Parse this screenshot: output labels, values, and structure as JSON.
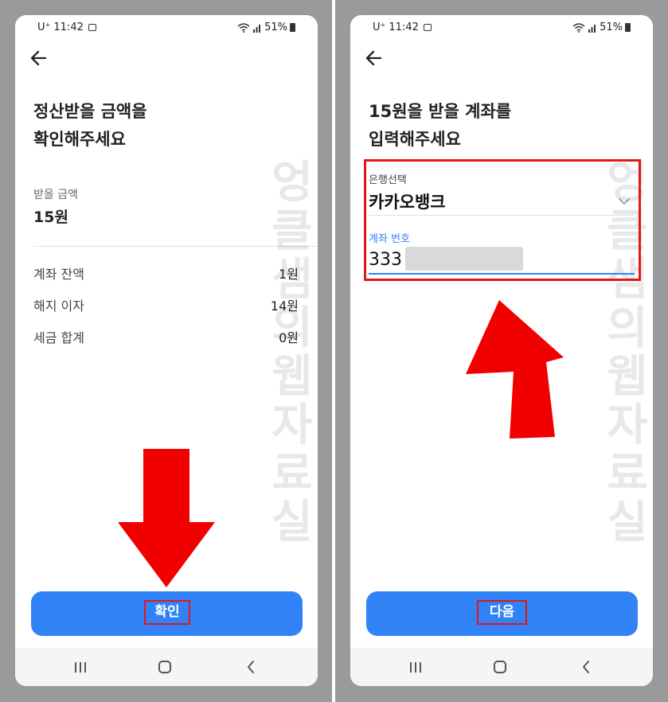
{
  "status_bar": {
    "carrier": "U⁺",
    "time": "11:42",
    "battery": "51%"
  },
  "left_screen": {
    "title_line1": "정산받을 금액을",
    "title_line2": "확인해주세요",
    "amount_label": "받을 금액",
    "amount_value": "15원",
    "rows": [
      {
        "label": "계좌 잔액",
        "value": "1원"
      },
      {
        "label": "해지 이자",
        "value": "14원"
      },
      {
        "label": "세금 합계",
        "value": "0원"
      }
    ],
    "confirm_button": "확인"
  },
  "right_screen": {
    "title_line1": "15원을 받을 계좌를",
    "title_line2": "입력해주세요",
    "bank_label": "은행선택",
    "bank_value": "카카오뱅크",
    "account_label": "계좌 번호",
    "account_value": "333",
    "next_button": "다음"
  },
  "watermark": [
    "엉",
    "클",
    "샘",
    "의",
    "웹",
    "자",
    "료",
    "실"
  ],
  "icons": {
    "back": "back-arrow-icon",
    "chevron": "chevron-down-icon",
    "recents": "recent-apps-icon",
    "home": "home-icon",
    "nav_back": "nav-back-icon",
    "wifi": "wifi-icon",
    "signal": "signal-icon",
    "battery": "battery-icon",
    "annotation_arrow": "red-arrow-icon"
  },
  "colors": {
    "primary": "#3182f6",
    "annotation_red": "#e01818",
    "text_dark": "#222222",
    "text_muted": "#666666"
  }
}
